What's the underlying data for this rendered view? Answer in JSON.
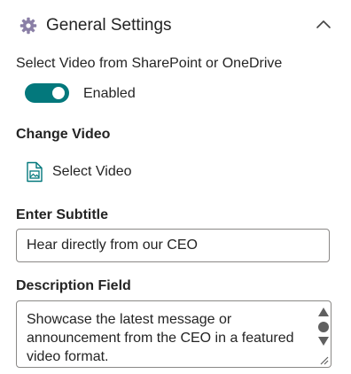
{
  "section": {
    "title": "General Settings",
    "icon": "gear-icon",
    "collapse_icon": "chevron-up-icon"
  },
  "video_source": {
    "label": "Select Video from SharePoint or OneDrive",
    "toggle_on": true,
    "toggle_state": "Enabled"
  },
  "change_video": {
    "label": "Change Video",
    "button_label": "Select Video",
    "icon": "video-file-icon"
  },
  "subtitle": {
    "label": "Enter Subtitle",
    "value": "Hear directly from our CEO"
  },
  "description": {
    "label": "Description Field",
    "value": "Showcase the latest message or announcement from the CEO in a featured video format."
  },
  "colors": {
    "accent": "#03787c",
    "text": "#242424",
    "border": "#8a8886"
  }
}
